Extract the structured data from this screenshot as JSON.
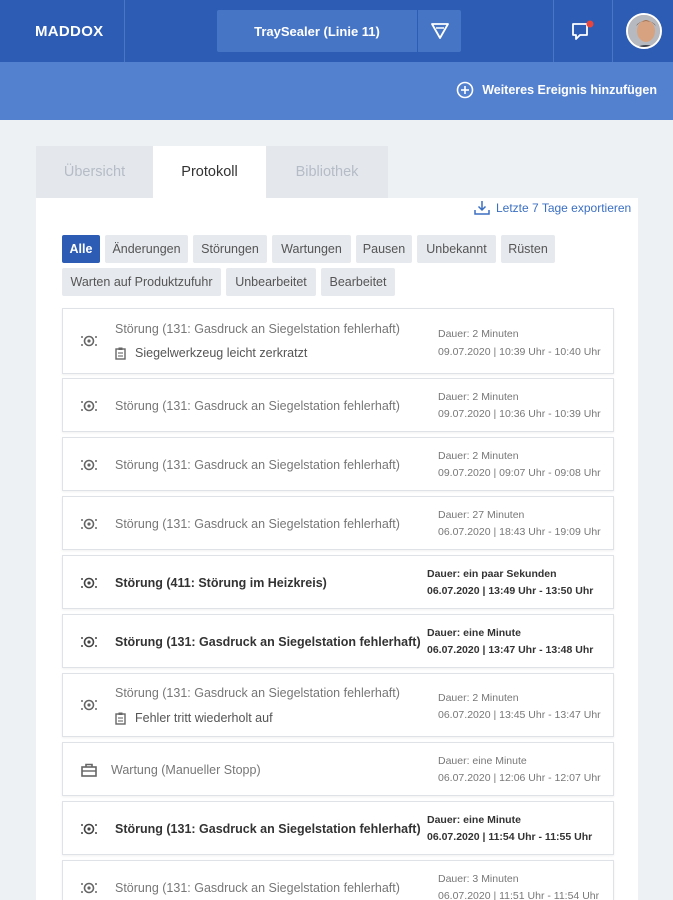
{
  "header": {
    "logo": "MADDOX",
    "machine": "TraySealer (Linie 11)",
    "add_event": "Weiteres Ereignis hinzufügen"
  },
  "tabs": [
    {
      "label": "Übersicht",
      "active": false
    },
    {
      "label": "Protokoll",
      "active": true
    },
    {
      "label": "Bibliothek",
      "active": false
    }
  ],
  "export_label": "Letzte 7 Tage exportieren",
  "filters": [
    {
      "label": "Alle",
      "active": true
    },
    {
      "label": "Änderungen",
      "active": false
    },
    {
      "label": "Störungen",
      "active": false
    },
    {
      "label": "Wartungen",
      "active": false
    },
    {
      "label": "Pausen",
      "active": false
    },
    {
      "label": "Unbekannt",
      "active": false
    },
    {
      "label": "Rüsten",
      "active": false
    },
    {
      "label": "Warten auf Produktzufuhr",
      "active": false
    },
    {
      "label": "Unbearbeitet",
      "active": false
    },
    {
      "label": "Bearbeitet",
      "active": false
    }
  ],
  "events": [
    {
      "type": "stoerung",
      "icon": "gear-icon",
      "title": "Störung (131: Gasdruck an Siegelstation fehlerhaft)",
      "note": "Siegelwerkzeug leicht zerkratzt",
      "duration": "Dauer: 2 Minuten",
      "time": "09.07.2020 | 10:39 Uhr - 10:40 Uhr",
      "bold": false
    },
    {
      "type": "stoerung",
      "icon": "gear-icon",
      "title": "Störung (131: Gasdruck an Siegelstation fehlerhaft)",
      "note": "",
      "duration": "Dauer: 2 Minuten",
      "time": "09.07.2020 | 10:36 Uhr - 10:39 Uhr",
      "bold": false
    },
    {
      "type": "stoerung",
      "icon": "gear-icon",
      "title": "Störung (131: Gasdruck an Siegelstation fehlerhaft)",
      "note": "",
      "duration": "Dauer: 2 Minuten",
      "time": "09.07.2020 | 09:07 Uhr - 09:08 Uhr",
      "bold": false
    },
    {
      "type": "stoerung",
      "icon": "gear-icon",
      "title": "Störung (131: Gasdruck an Siegelstation fehlerhaft)",
      "note": "",
      "duration": "Dauer: 27 Minuten",
      "time": "06.07.2020 | 18:43 Uhr - 19:09 Uhr",
      "bold": false
    },
    {
      "type": "stoerung",
      "icon": "gear-icon",
      "title": "Störung (411: Störung im Heizkreis)",
      "note": "",
      "duration": "Dauer: ein paar Sekunden",
      "time": "06.07.2020 | 13:49 Uhr - 13:50 Uhr",
      "bold": true
    },
    {
      "type": "stoerung",
      "icon": "gear-icon",
      "title": "Störung (131: Gasdruck an Siegelstation fehlerhaft)",
      "note": "",
      "duration": "Dauer: eine Minute",
      "time": "06.07.2020 | 13:47 Uhr - 13:48 Uhr",
      "bold": true
    },
    {
      "type": "stoerung",
      "icon": "gear-icon",
      "title": "Störung (131: Gasdruck an Siegelstation fehlerhaft)",
      "note": "Fehler tritt wiederholt auf",
      "duration": "Dauer: 2 Minuten",
      "time": "06.07.2020 | 13:45 Uhr - 13:47 Uhr",
      "bold": false
    },
    {
      "type": "wartung",
      "icon": "toolbox-icon",
      "title": "Wartung (Manueller Stopp)",
      "note": "",
      "duration": "Dauer: eine Minute",
      "time": "06.07.2020 | 12:06 Uhr - 12:07 Uhr",
      "bold": false
    },
    {
      "type": "stoerung",
      "icon": "gear-icon",
      "title": "Störung (131: Gasdruck an Siegelstation fehlerhaft)",
      "note": "",
      "duration": "Dauer: eine Minute",
      "time": "06.07.2020 | 11:54 Uhr - 11:55 Uhr",
      "bold": true
    },
    {
      "type": "stoerung",
      "icon": "gear-icon",
      "title": "Störung (131: Gasdruck an Siegelstation fehlerhaft)",
      "note": "",
      "duration": "Dauer: 3 Minuten",
      "time": "06.07.2020 | 11:51 Uhr - 11:54 Uhr",
      "bold": false
    }
  ]
}
